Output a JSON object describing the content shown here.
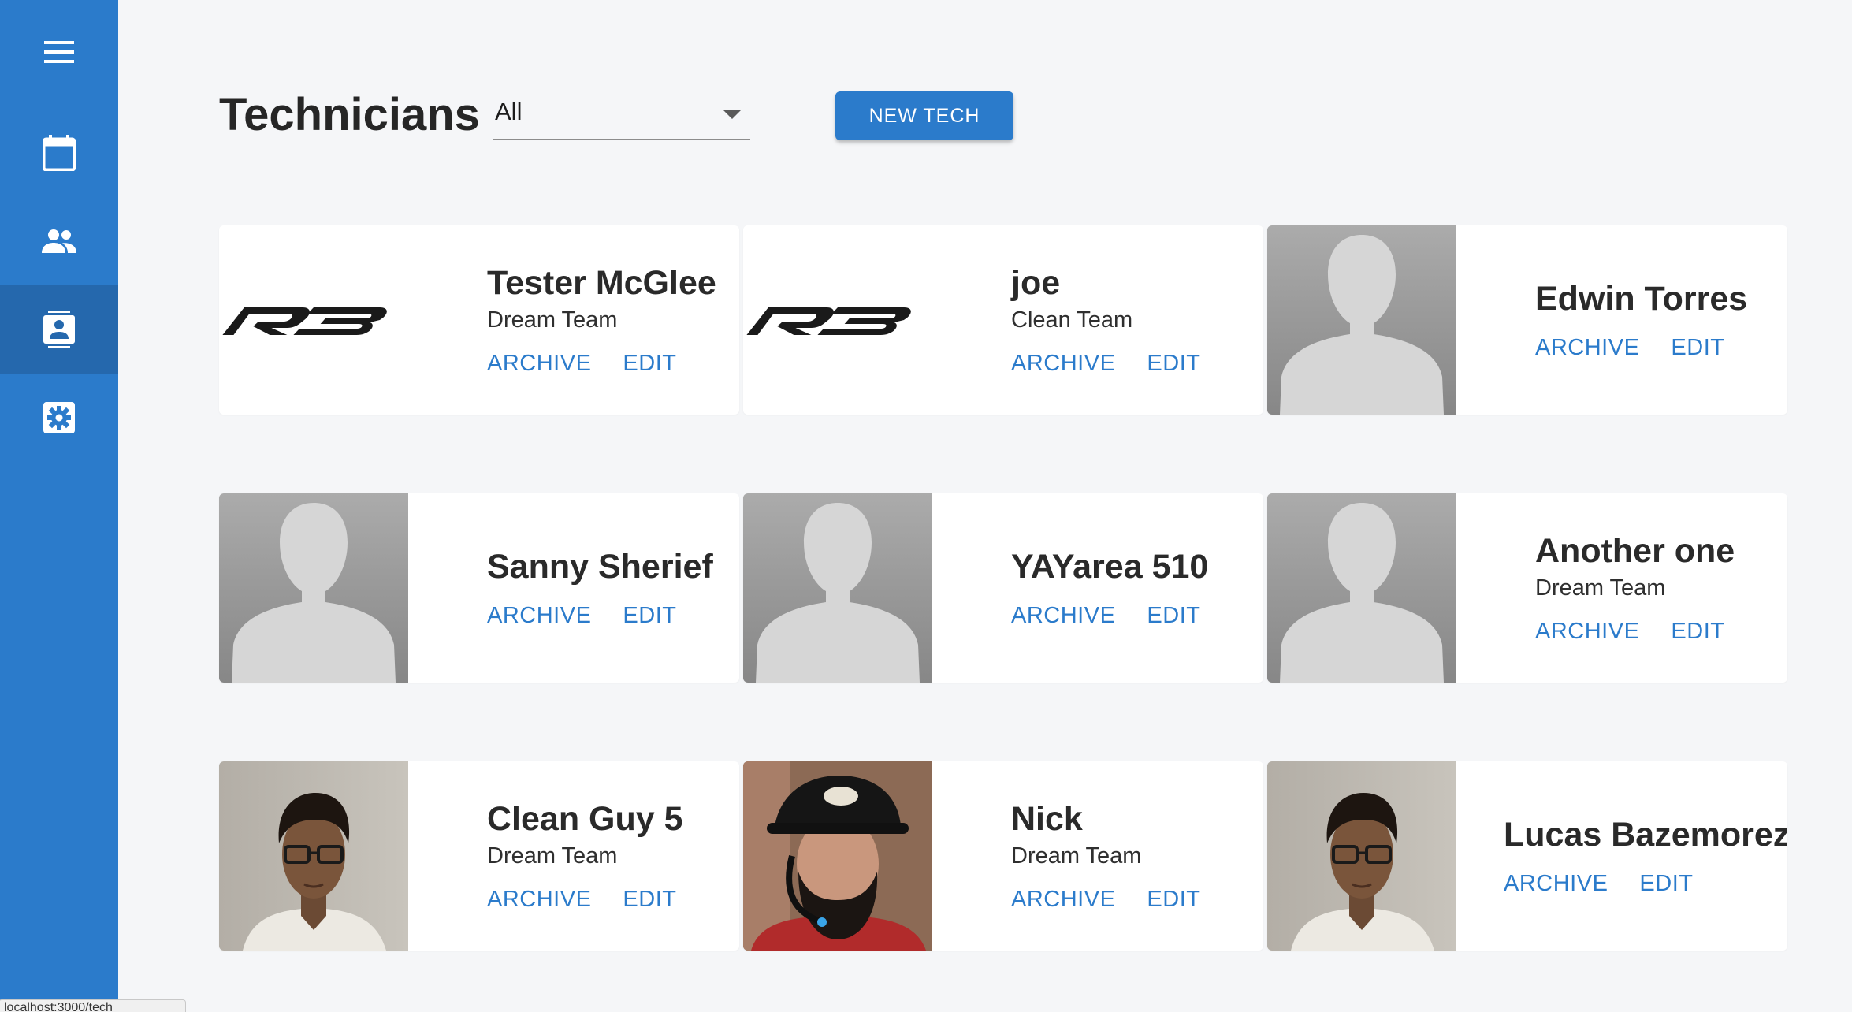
{
  "page": {
    "title": "Technicians"
  },
  "filter": {
    "selected": "All"
  },
  "toolbar": {
    "new_tech_label": "NEW TECH"
  },
  "sidebar": {
    "items": [
      {
        "icon": "menu-icon"
      },
      {
        "icon": "calendar-icon"
      },
      {
        "icon": "people-icon"
      },
      {
        "icon": "contact-card-icon",
        "active": true
      },
      {
        "icon": "settings-icon"
      }
    ]
  },
  "actions": {
    "archive": "ARCHIVE",
    "edit": "EDIT"
  },
  "technicians": [
    {
      "name": "Tester McGlee",
      "team": "Dream Team",
      "avatar": "r3-logo"
    },
    {
      "name": "joe",
      "team": "Clean Team",
      "avatar": "r3-logo"
    },
    {
      "name": "Edwin Torres",
      "team": "",
      "avatar": "placeholder"
    },
    {
      "name": "Sanny Sherief",
      "team": "",
      "avatar": "placeholder"
    },
    {
      "name": "YAYarea 510",
      "team": "",
      "avatar": "placeholder"
    },
    {
      "name": "Another one",
      "team": "Dream Team",
      "avatar": "placeholder"
    },
    {
      "name": "Clean Guy 5",
      "team": "Dream Team",
      "avatar": "photo-glasses"
    },
    {
      "name": "Nick",
      "team": "Dream Team",
      "avatar": "photo-beard"
    },
    {
      "name": "Lucas Bazemorez",
      "team": "",
      "avatar": "photo-glasses"
    }
  ],
  "colors": {
    "primary": "#2b7bcb",
    "sidebar_active": "#2568ad",
    "background": "#f5f6f8"
  },
  "status_bar": {
    "url": "localhost:3000/tech"
  }
}
